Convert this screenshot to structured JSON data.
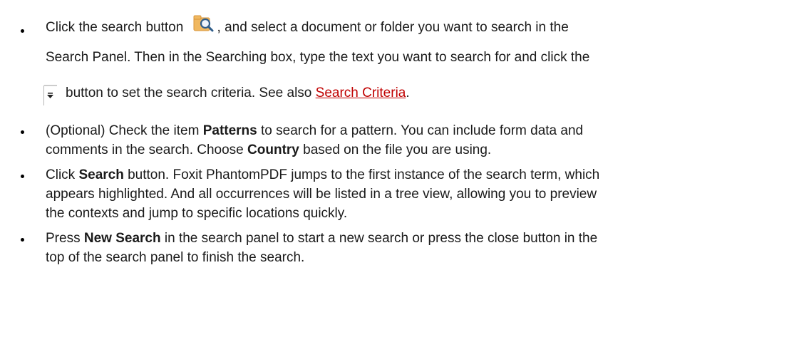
{
  "items": [
    {
      "line1": {
        "before_icon": "Click the search button ",
        "after_icon": ", and select a document or folder you want to search in the"
      },
      "line2": "Search Panel. Then in the Searching box, type the text you want to search for and click the",
      "line3": {
        "text": "button to set the search criteria. See also ",
        "link": "Search Criteria",
        "after_link": "."
      },
      "icons": {
        "search_button": "folder-search-icon",
        "criteria_button": "dropdown-arrow-icon"
      }
    },
    {
      "line1": {
        "before": "(Optional) Check the item ",
        "bold": "Patterns",
        "after": " to search for a pattern. You can include form data and"
      },
      "line2": {
        "before": "comments in the search. Choose ",
        "bold": "Country",
        "after": " based on the file you are using."
      }
    },
    {
      "line1": {
        "before": "Click ",
        "bold": "Search",
        "after": " button. Foxit PhantomPDF jumps to the first instance of the search term, which"
      },
      "line2": "appears highlighted. And all occurrences will be listed in a tree view, allowing you to preview",
      "line3": "the contexts and jump to specific locations quickly."
    },
    {
      "line1": {
        "before": "Press ",
        "bold": "New Search",
        "after": " in the search panel to start a new search or press the close button in the"
      },
      "line2": "top of the search panel to finish the search."
    }
  ],
  "colors": {
    "link": "#c00000",
    "text": "#1a1a1a",
    "folder_icon": "#f0b860",
    "magnifier_icon": "#2f5d8a"
  }
}
